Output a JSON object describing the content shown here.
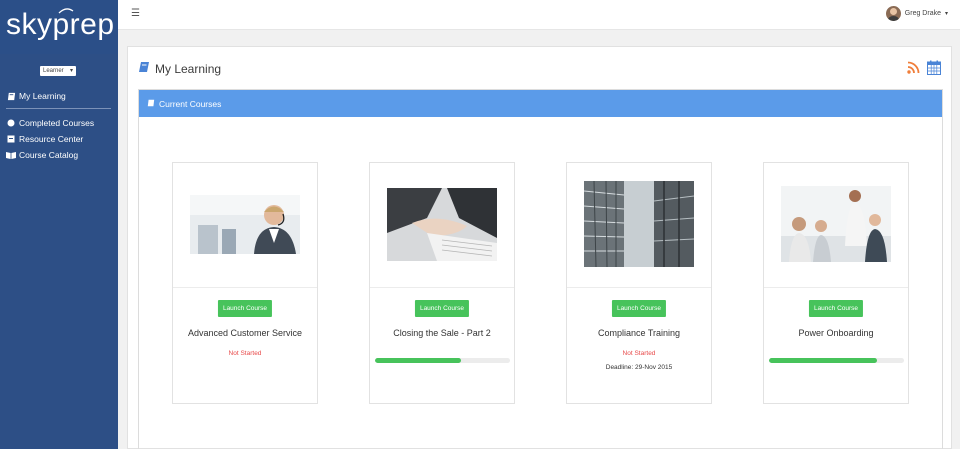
{
  "brand": {
    "logo_text": "skyprep"
  },
  "sidebar": {
    "role": "Learner",
    "items": [
      {
        "label": "My Learning",
        "icon": "book-icon"
      },
      {
        "label": "Completed Courses",
        "icon": "circle-icon"
      },
      {
        "label": "Resource Center",
        "icon": "archive-icon"
      },
      {
        "label": "Course Catalog",
        "icon": "open-book-icon"
      }
    ]
  },
  "topbar": {
    "user_name": "Greg Drake"
  },
  "main": {
    "title": "My Learning",
    "section_title": "Current Courses",
    "launch_label": "Launch Course",
    "courses": [
      {
        "title": "Advanced Customer Service",
        "status": "Not Started",
        "progress": null,
        "deadline": ""
      },
      {
        "title": "Closing the Sale - Part 2",
        "status": "",
        "progress": 0.64,
        "deadline": ""
      },
      {
        "title": "Compliance Training",
        "status": "Not Started",
        "progress": null,
        "deadline": "Deadline: 29-Nov 2015"
      },
      {
        "title": "Power Onboarding",
        "status": "",
        "progress": 0.8,
        "deadline": ""
      }
    ]
  },
  "colors": {
    "sidebar": "#2d4f86",
    "header": "#5b9be9",
    "button": "#47c35b",
    "status": "#e84a4a",
    "rss": "#f07e3a"
  }
}
